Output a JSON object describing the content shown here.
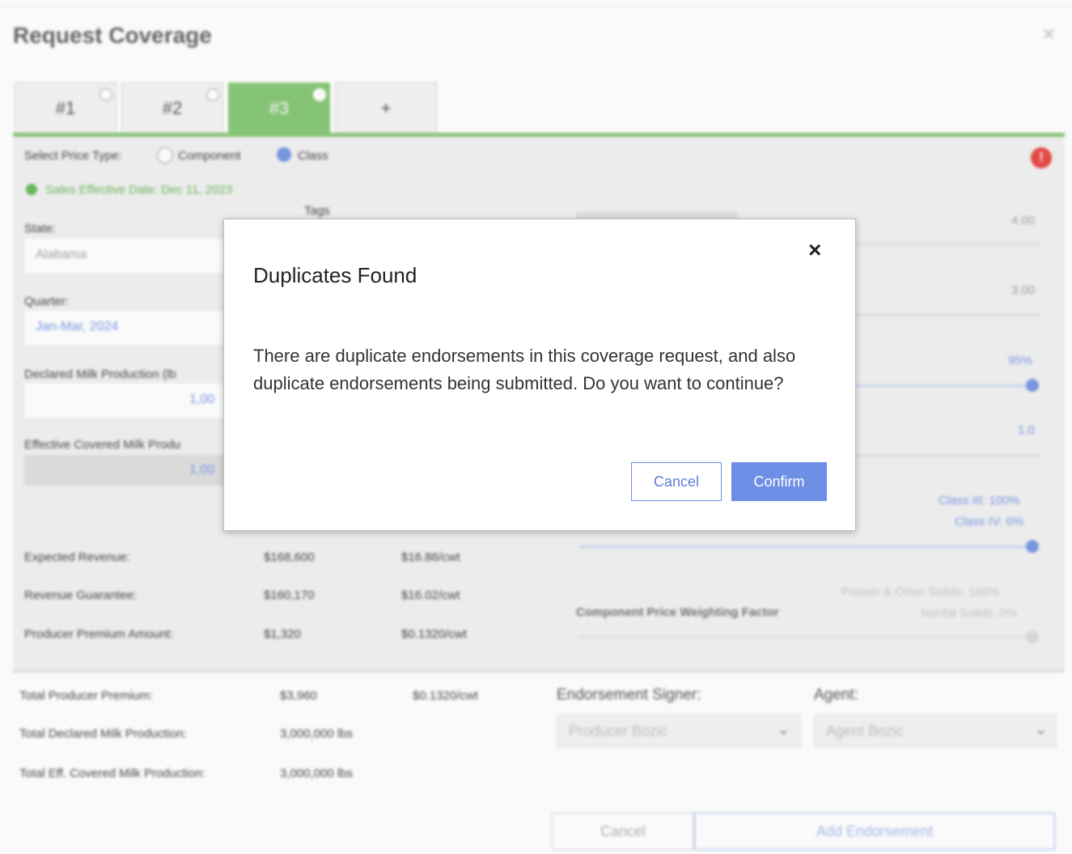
{
  "dialog": {
    "title": "Request Coverage",
    "tabs": [
      {
        "label": "#1",
        "active": false
      },
      {
        "label": "#2",
        "active": false
      },
      {
        "label": "#3",
        "active": true
      },
      {
        "label": "+",
        "active": false
      }
    ],
    "price_type": {
      "label": "Select Price Type:",
      "options": [
        "Component",
        "Class"
      ],
      "selected": "Class"
    },
    "sales_effective": "Sales Effective Date: Dec 11, 2023",
    "tags_label": "Tags",
    "state": {
      "label": "State:",
      "value": "Alabama"
    },
    "quarter": {
      "label": "Quarter:",
      "value": "Jan-Mar, 2024"
    },
    "declared_production": {
      "label": "Declared Milk Production (lb",
      "value": "1,00"
    },
    "effective_production": {
      "label": "Effective Covered Milk Produ",
      "value": "1,00"
    },
    "right_values": {
      "declared_butterfat": "4.00",
      "protein": "3.00",
      "coverage_level": "95%",
      "protection_factor": "1.0",
      "class_weighting": [
        "Class III: 100%",
        "Class IV: 0%"
      ],
      "component_weighting": [
        "Protein & Other Solids: 100%",
        "Nonfat Solids: 0%"
      ],
      "component_weighting_label": "Component Price Weighting Factor"
    },
    "revenue_rows": [
      {
        "label": "Expected Revenue:",
        "amount": "$168,600",
        "per_cwt": "$16.86/cwt"
      },
      {
        "label": "Revenue Guarantee:",
        "amount": "$160,170",
        "per_cwt": "$16.02/cwt"
      },
      {
        "label": "Producer Premium Amount:",
        "amount": "$1,320",
        "per_cwt": "$0.1320/cwt"
      }
    ],
    "totals": [
      {
        "label": "Total Producer Premium:",
        "value": "$3,960",
        "extra": "$0.1320/cwt"
      },
      {
        "label": "Total Declared Milk Production:",
        "value": "3,000,000 lbs",
        "extra": ""
      },
      {
        "label": "Total Eff. Covered Milk Production:",
        "value": "3,000,000 lbs",
        "extra": ""
      }
    ],
    "endorsement_signer": {
      "label": "Endorsement Signer:",
      "value": "Producer Bozic"
    },
    "agent": {
      "label": "Agent:",
      "value": "Agent Bozic"
    },
    "cancel_label": "Cancel",
    "add_endorsement_label": "Add Endorsement"
  },
  "modal": {
    "title": "Duplicates Found",
    "message": "There are duplicate endorsements in this coverage request, and also duplicate endorsements being submitted. Do you want to continue?",
    "cancel_label": "Cancel",
    "confirm_label": "Confirm",
    "close_icon": "×"
  },
  "colors": {
    "accent": "#6f8fe6",
    "tab_active": "#7cc26a",
    "error": "#e53935"
  }
}
